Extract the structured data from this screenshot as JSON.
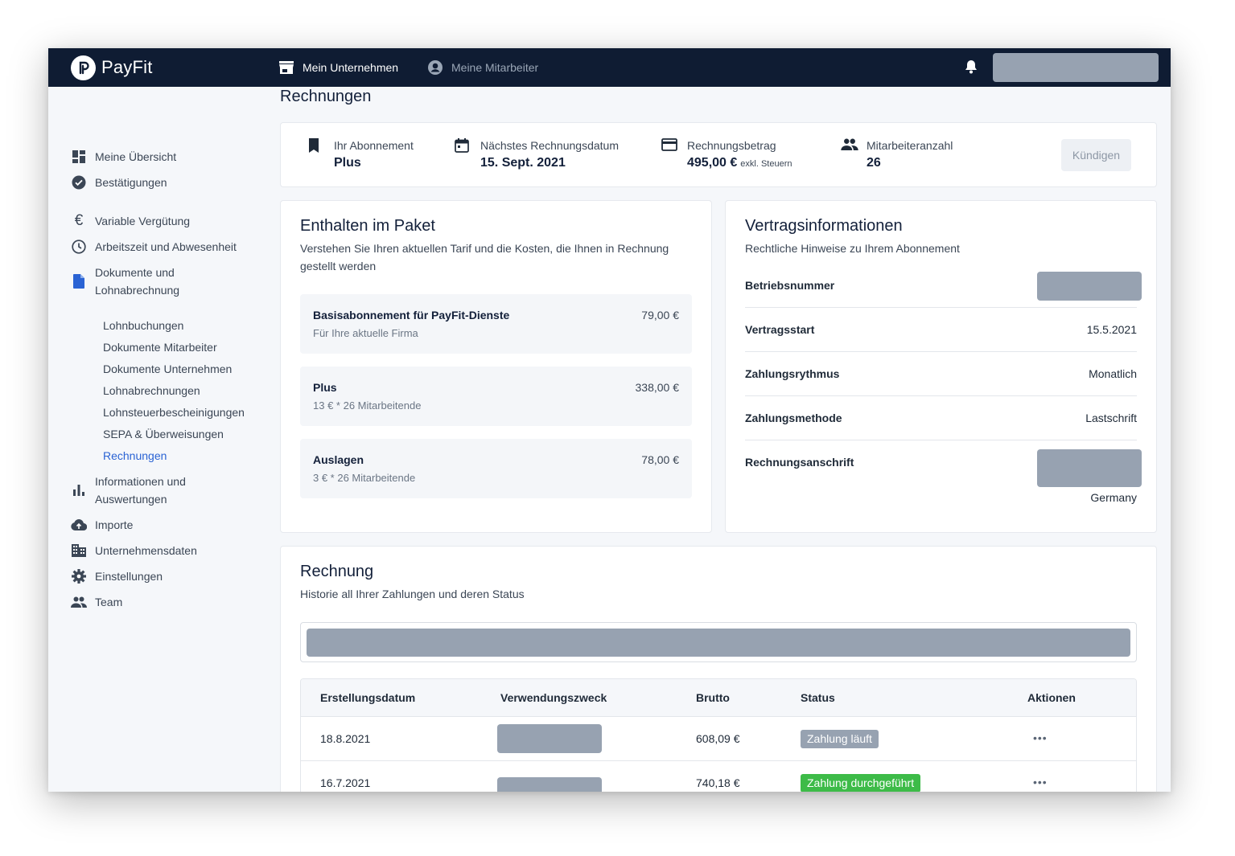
{
  "app": {
    "name": "PayFit"
  },
  "topnav": [
    {
      "label": "Mein Unternehmen",
      "icon": "store-icon",
      "active": true
    },
    {
      "label": "Meine Mitarbeiter",
      "icon": "account-circle-icon",
      "active": false
    }
  ],
  "sidebar": {
    "items": [
      {
        "label": "Meine Übersicht",
        "icon": "dashboard-icon"
      },
      {
        "label": "Bestätigungen",
        "icon": "check-circle-icon"
      },
      {
        "label": "Variable Vergütung",
        "icon": "euro-icon"
      },
      {
        "label": "Arbeitszeit und Abwesenheit",
        "icon": "clock-icon"
      },
      {
        "label_line1": "Dokumente und",
        "label_line2": "Lohnabrechnung",
        "icon": "document-icon"
      },
      {
        "label_line1": "Informationen und",
        "label_line2": "Auswertungen",
        "icon": "bar-chart-icon"
      },
      {
        "label": "Importe",
        "icon": "cloud-upload-icon"
      },
      {
        "label": "Unternehmensdaten",
        "icon": "building-icon"
      },
      {
        "label": "Einstellungen",
        "icon": "gear-icon"
      },
      {
        "label": "Team",
        "icon": "people-icon"
      }
    ],
    "subitems": [
      "Lohnbuchungen",
      "Dokumente Mitarbeiter",
      "Dokumente Unternehmen",
      "Lohnabrechnungen",
      "Lohnsteuerbescheinigungen",
      "SEPA & Überweisungen",
      "Rechnungen"
    ]
  },
  "page": {
    "title": "Rechnungen"
  },
  "summary": {
    "abo_label": "Ihr Abonnement",
    "abo_value": "Plus",
    "date_label": "Nächstes Rechnungsdatum",
    "date_value": "15. Sept. 2021",
    "amount_label": "Rechnungsbetrag",
    "amount_value": "495,00 €",
    "amount_note": "exkl. Steuern",
    "count_label": "Mitarbeiteranzahl",
    "count_value": "26",
    "cancel_label": "Kündigen"
  },
  "paket": {
    "title": "Enthalten im Paket",
    "subtitle_line1": "Verstehen Sie Ihren aktuellen Tarif und die Kosten, die Ihnen in Rechnung",
    "subtitle_line2": "gestellt werden",
    "items": [
      {
        "name": "Basisabonnement für PayFit-Dienste",
        "desc": "Für Ihre aktuelle Firma",
        "price": "79,00 €"
      },
      {
        "name": "Plus",
        "desc": "13 € * 26 Mitarbeitende",
        "price": "338,00 €"
      },
      {
        "name": "Auslagen",
        "desc": "3 € * 26 Mitarbeitende",
        "price": "78,00 €"
      }
    ]
  },
  "vertrag": {
    "title": "Vertragsinformationen",
    "subtitle": "Rechtliche Hinweise zu Ihrem Abonnement",
    "rows": [
      {
        "label": "Betriebsnummer",
        "value": ""
      },
      {
        "label": "Vertragsstart",
        "value": "15.5.2021"
      },
      {
        "label": "Zahlungsrythmus",
        "value": "Monatlich"
      },
      {
        "label": "Zahlungsmethode",
        "value": "Lastschrift"
      },
      {
        "label": "Rechnungsanschrift",
        "value": "Germany"
      }
    ]
  },
  "rechnung": {
    "title": "Rechnung",
    "subtitle": "Historie all Ihrer Zahlungen und deren Status",
    "columns": [
      "Erstellungsdatum",
      "Verwendungszweck",
      "Brutto",
      "Status",
      "Aktionen"
    ],
    "rows": [
      {
        "date": "18.8.2021",
        "amount": "608,09 €",
        "status": "Zahlung läuft",
        "status_color": "#97a2b1",
        "actions": "•••"
      },
      {
        "date": "16.7.2021",
        "amount": "740,18 €",
        "status": "Zahlung durchgeführt",
        "status_color": "#3dbb48",
        "actions": "•••"
      }
    ]
  },
  "colors": {
    "topbar": "#0f1c33",
    "accent": "#2a63d4",
    "placeholder": "#97a2b1"
  }
}
